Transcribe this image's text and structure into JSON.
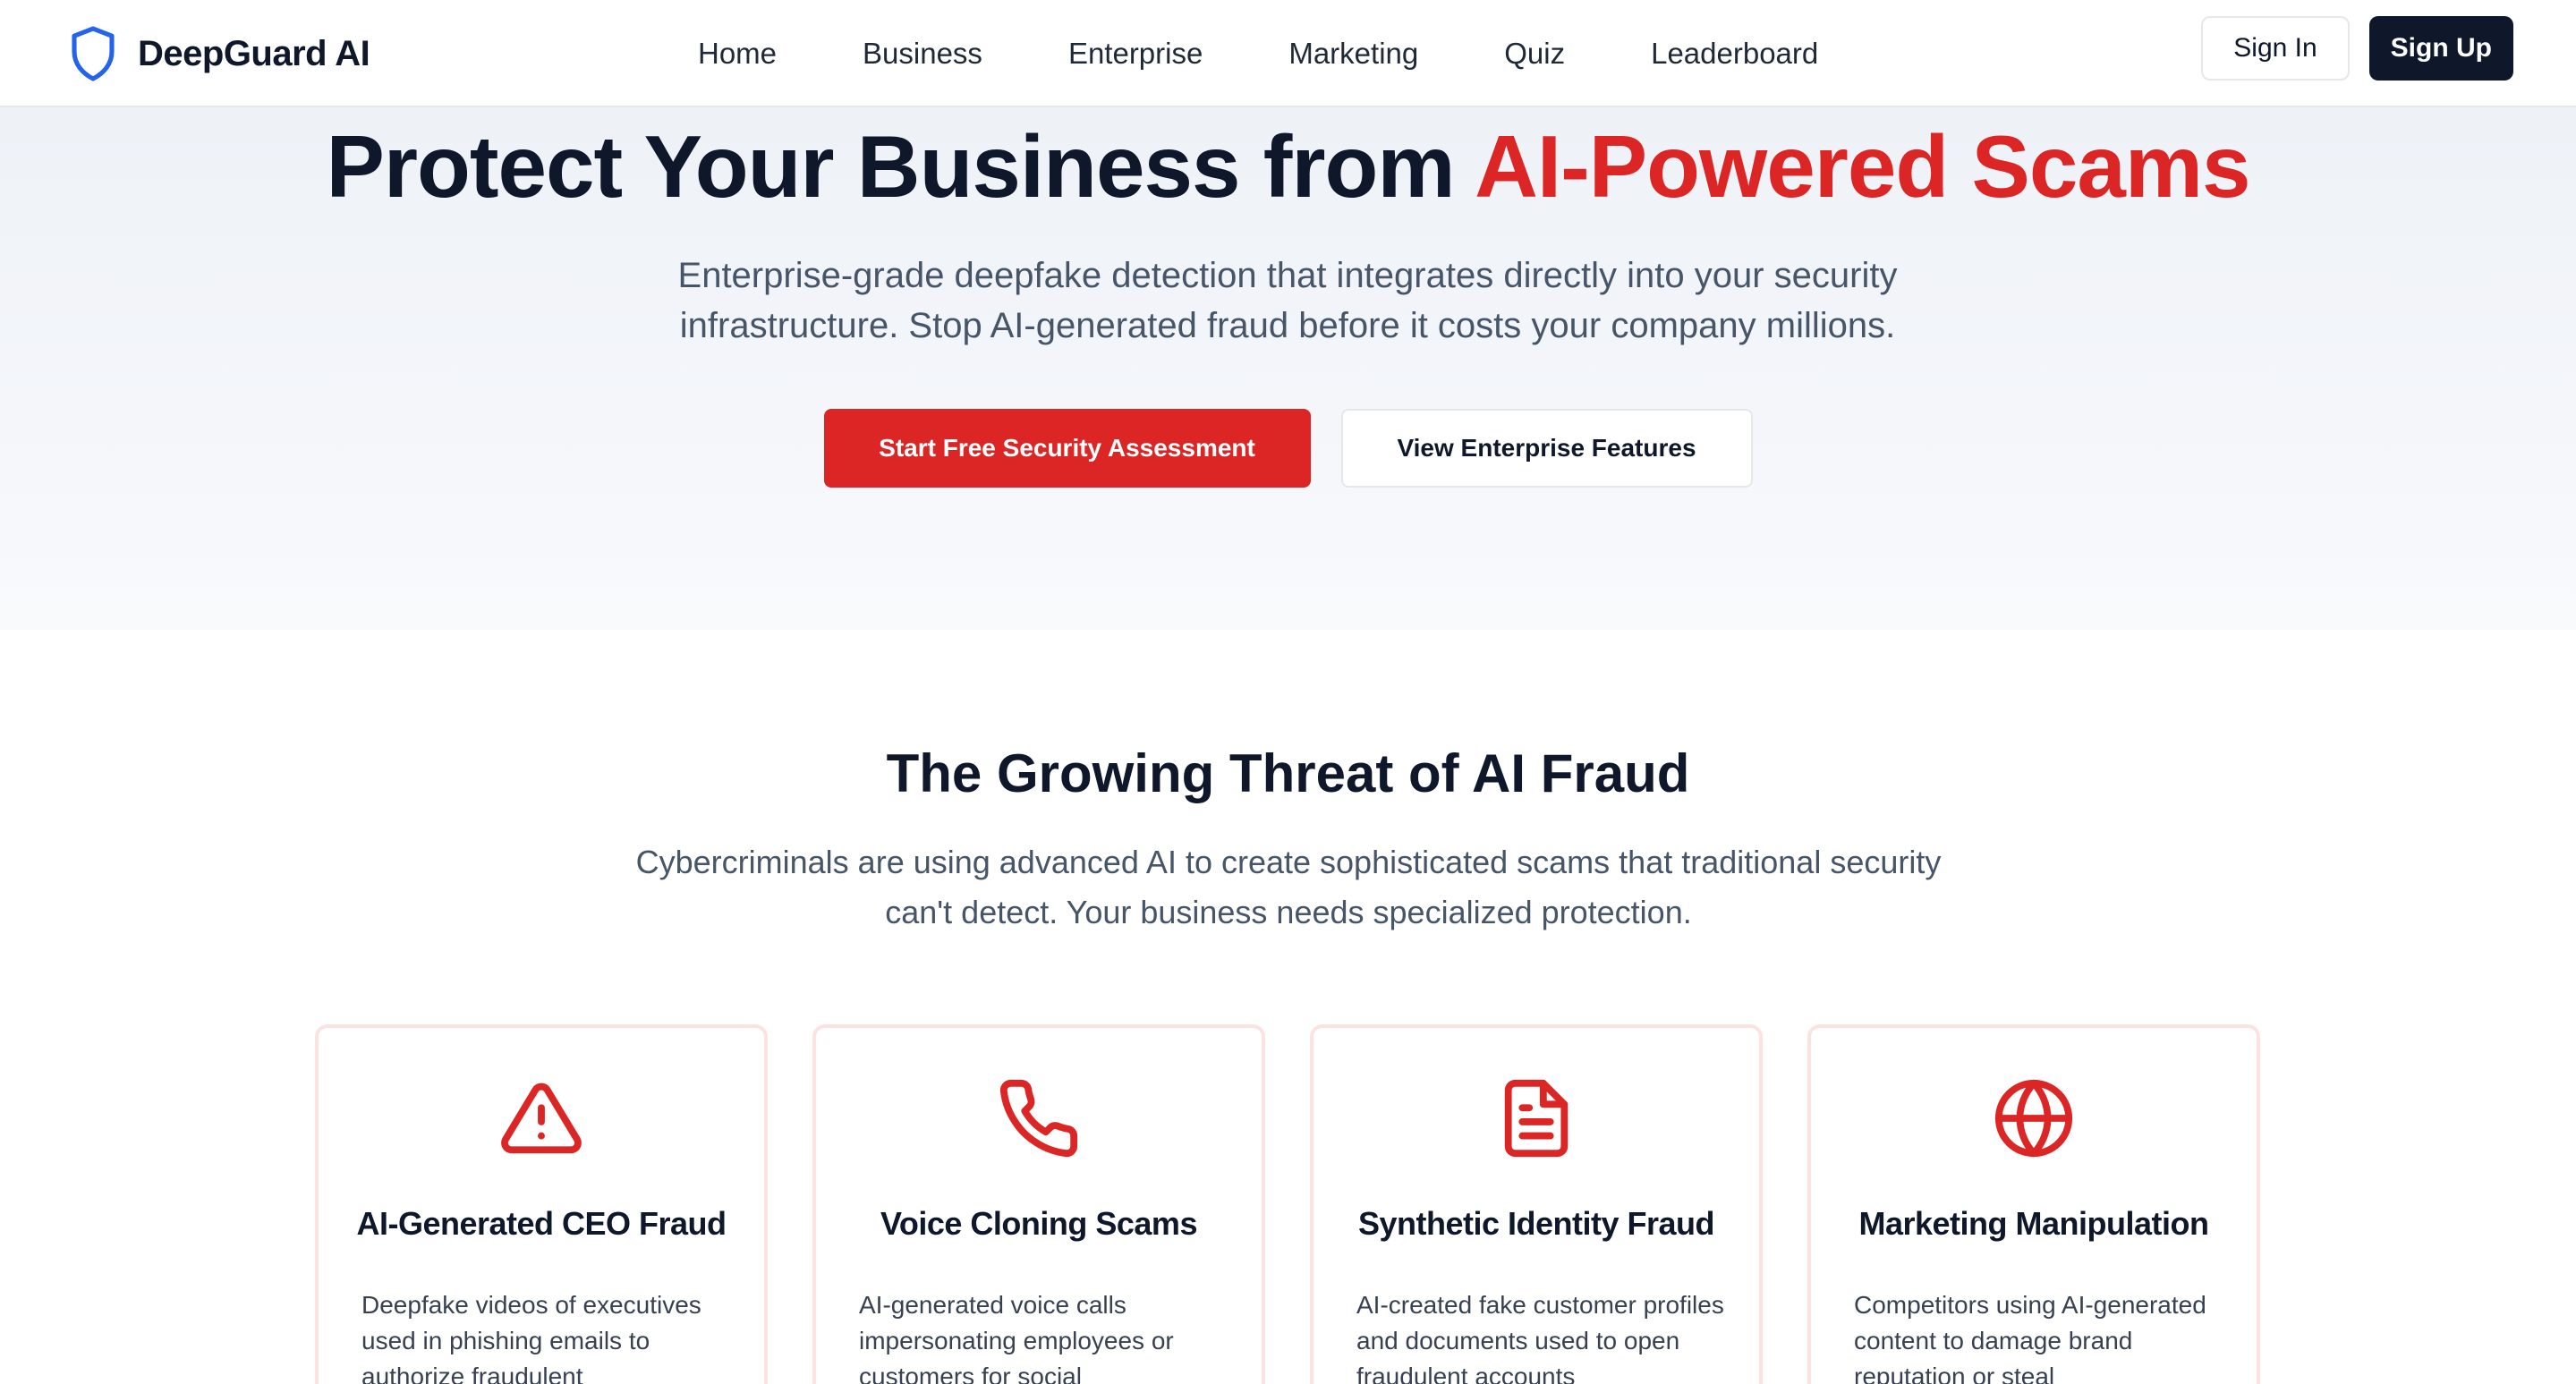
{
  "header": {
    "brand": "DeepGuard AI",
    "nav": [
      "Home",
      "Business",
      "Enterprise",
      "Marketing",
      "Quiz",
      "Leaderboard"
    ],
    "sign_in": "Sign In",
    "sign_up": "Sign Up"
  },
  "hero": {
    "title_main": "Protect Your Business from ",
    "title_accent": "AI-Powered Scams",
    "subtitle": "Enterprise-grade deepfake detection that integrates directly into your security infrastructure. Stop AI-generated fraud before it costs your company millions.",
    "primary_cta": "Start Free Security Assessment",
    "secondary_cta": "View Enterprise Features"
  },
  "threats": {
    "title": "The Growing Threat of AI Fraud",
    "subtitle": "Cybercriminals are using advanced AI to create sophisticated scams that traditional security can't detect. Your business needs specialized protection.",
    "cards": [
      {
        "icon": "warning-triangle-icon",
        "title": "AI-Generated CEO Fraud",
        "desc": "Deepfake videos of executives used in phishing emails to authorize fraudulent"
      },
      {
        "icon": "phone-icon",
        "title": "Voice Cloning Scams",
        "desc": "AI-generated voice calls impersonating employees or customers for social"
      },
      {
        "icon": "document-icon",
        "title": "Synthetic Identity Fraud",
        "desc": "AI-created fake customer profiles and documents used to open fraudulent accounts"
      },
      {
        "icon": "globe-icon",
        "title": "Marketing Manipulation",
        "desc": "Competitors using AI-generated content to damage brand reputation or steal"
      }
    ]
  },
  "colors": {
    "accent": "#dc2626",
    "brand_icon": "#2563eb",
    "dark": "#0f172a"
  }
}
